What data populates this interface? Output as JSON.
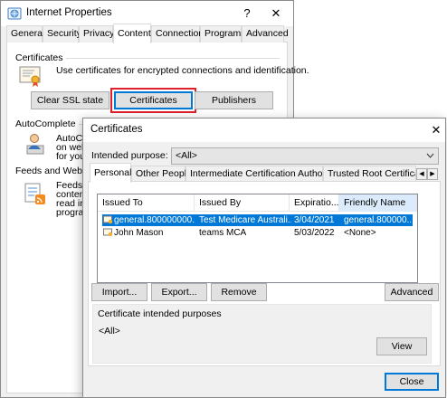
{
  "internet_properties": {
    "title": "Internet Properties",
    "help_label": "?",
    "close_label": "✕",
    "tabs": [
      "General",
      "Security",
      "Privacy",
      "Content",
      "Connections",
      "Programs",
      "Advanced"
    ],
    "active_tab": "Content",
    "certificates_group": {
      "label": "Certificates",
      "description": "Use certificates for encrypted connections and identification.",
      "clear_ssl_label": "Clear SSL state",
      "certificates_label": "Certificates",
      "publishers_label": "Publishers"
    },
    "autocomplete_group": {
      "label": "AutoComplete",
      "text_lines": [
        "AutoCo",
        "on web",
        "for you"
      ]
    },
    "feeds_group": {
      "label": "Feeds and Web Slic",
      "text_lines": [
        "Feeds a",
        "content",
        "read in",
        "progra"
      ]
    }
  },
  "certificates_dialog": {
    "title": "Certificates",
    "close_label": "✕",
    "intended_purpose_label": "Intended purpose:",
    "intended_purpose_value": "<All>",
    "tabs": [
      "Personal",
      "Other People",
      "Intermediate Certification Authorities",
      "Trusted Root Certification"
    ],
    "active_tab": "Personal",
    "columns": [
      "Issued To",
      "Issued By",
      "Expiratio...",
      "Friendly Name"
    ],
    "rows": [
      {
        "issued_to": "general.800000000...",
        "issued_by": "Test Medicare Australi...",
        "expiration": "3/04/2021",
        "friendly_name": "general.800000...",
        "selected": true
      },
      {
        "issued_to": "John Mason",
        "issued_by": "teams MCA",
        "expiration": "5/03/2022",
        "friendly_name": "<None>",
        "selected": false
      }
    ],
    "import_label": "Import...",
    "export_label": "Export...",
    "remove_label": "Remove",
    "advanced_label": "Advanced",
    "purposes_group_label": "Certificate intended purposes",
    "purposes_value": "<All>",
    "view_label": "View",
    "close_button_label": "Close"
  },
  "colors": {
    "selection": "#0078d7",
    "highlight_outline": "#e0202a",
    "dialog_background": "#f0f0f0"
  },
  "icons": [
    "internet-options-icon",
    "certificate-icon",
    "autocomplete-person-icon",
    "feeds-rss-icon",
    "certificate-small-icon",
    "tab-scroll-left-icon",
    "tab-scroll-right-icon",
    "chevron-down-icon"
  ]
}
